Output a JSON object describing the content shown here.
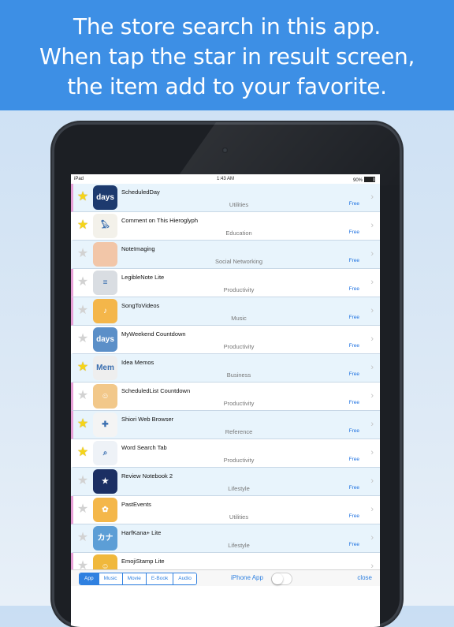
{
  "banner": {
    "line1": "The store search in this app.",
    "line2": "When tap the star in result screen,",
    "line3": "the item add to your favorite."
  },
  "status": {
    "device": "iPad",
    "time": "1:43 AM",
    "battery": "90%"
  },
  "items": [
    {
      "name": "ScheduledDay",
      "category": "Utilities",
      "price": "Free",
      "fav": true,
      "icon": "days-icon",
      "iconText": "days",
      "iconColor": "#1d3a6e"
    },
    {
      "name": "Comment on This Hieroglyph",
      "category": "Education",
      "price": "Free",
      "fav": true,
      "icon": "hieroglyph-icon",
      "iconText": "𓅃",
      "iconColor": "#f3f1ea"
    },
    {
      "name": "NoteImaging",
      "category": "Social Networking",
      "price": "Free",
      "fav": false,
      "icon": "note-imaging-icon",
      "iconText": "",
      "iconColor": "#f2c6a8"
    },
    {
      "name": "LegibleNote Lite",
      "category": "Productivity",
      "price": "Free",
      "fav": false,
      "icon": "legible-note-icon",
      "iconText": "≡",
      "iconColor": "#d9dde2"
    },
    {
      "name": "SongToVideos",
      "category": "Music",
      "price": "Free",
      "fav": false,
      "icon": "song-to-videos-icon",
      "iconText": "♪",
      "iconColor": "#f4b64a"
    },
    {
      "name": "MyWeekend Countdown",
      "category": "Productivity",
      "price": "Free",
      "fav": false,
      "icon": "weekend-countdown-icon",
      "iconText": "days",
      "iconColor": "#5b8fc8"
    },
    {
      "name": "Idea Memos",
      "category": "Business",
      "price": "Free",
      "fav": true,
      "icon": "idea-memos-icon",
      "iconText": "Mem",
      "iconColor": "#eeeeee"
    },
    {
      "name": "ScheduledList Countdown",
      "category": "Productivity",
      "price": "Free",
      "fav": false,
      "icon": "scheduled-list-icon",
      "iconText": "☺",
      "iconColor": "#f2c88a"
    },
    {
      "name": "Shiori Web Browser",
      "category": "Reference",
      "price": "Free",
      "fav": true,
      "icon": "browser-compass-icon",
      "iconText": "✚",
      "iconColor": "#f4f4f4"
    },
    {
      "name": "Word Search Tab",
      "category": "Productivity",
      "price": "Free",
      "fav": true,
      "icon": "magnifier-icon",
      "iconText": "⌕",
      "iconColor": "#eef2f7"
    },
    {
      "name": "Review Notebook 2",
      "category": "Lifestyle",
      "price": "Free",
      "fav": false,
      "icon": "review-notebook-icon",
      "iconText": "★",
      "iconColor": "#1b2f63"
    },
    {
      "name": "PastEvents",
      "category": "Utilities",
      "price": "Free",
      "fav": false,
      "icon": "sunflower-icon",
      "iconText": "✿",
      "iconColor": "#f4b74a"
    },
    {
      "name": "HarfKana+ Lite",
      "category": "Lifestyle",
      "price": "Free",
      "fav": false,
      "icon": "kana-icon",
      "iconText": "カナ",
      "iconColor": "#5c9ed6"
    },
    {
      "name": "EmojiStamp Lite",
      "category": "",
      "price": "",
      "fav": false,
      "icon": "emoji-stamp-icon",
      "iconText": "☺",
      "iconColor": "#f0b83c"
    }
  ],
  "toolbar": {
    "segments": [
      "App",
      "Music",
      "Movie",
      "E-Book",
      "Audio"
    ],
    "selected": "App",
    "iphone_label": "iPhone App",
    "close_label": "close"
  },
  "colors": {
    "banner": "#3d8fe5",
    "accent": "#2f80e0",
    "star_on": "#f5d418"
  }
}
